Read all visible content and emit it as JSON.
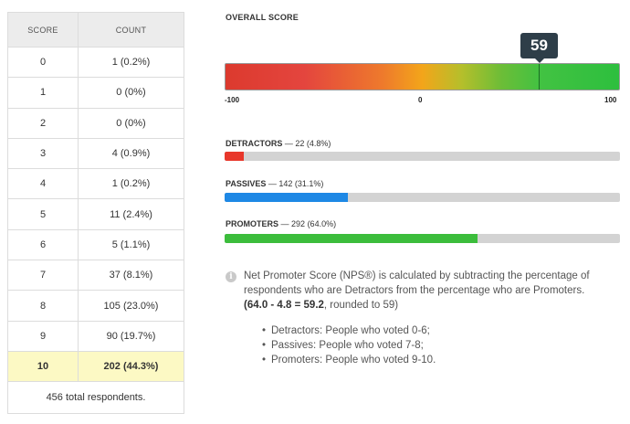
{
  "table": {
    "headers": {
      "score": "SCORE",
      "count": "COUNT"
    },
    "rows": [
      {
        "score": "0",
        "count": "1 (0.2%)"
      },
      {
        "score": "1",
        "count": "0 (0%)"
      },
      {
        "score": "2",
        "count": "0 (0%)"
      },
      {
        "score": "3",
        "count": "4 (0.9%)"
      },
      {
        "score": "4",
        "count": "1 (0.2%)"
      },
      {
        "score": "5",
        "count": "11 (2.4%)"
      },
      {
        "score": "6",
        "count": "5 (1.1%)"
      },
      {
        "score": "7",
        "count": "37 (8.1%)"
      },
      {
        "score": "8",
        "count": "105 (23.0%)"
      },
      {
        "score": "9",
        "count": "90 (19.7%)"
      },
      {
        "score": "10",
        "count": "202 (44.3%)"
      }
    ],
    "highlighted_row": 10,
    "footer": "456 total respondents."
  },
  "overall": {
    "label": "OVERALL SCORE",
    "score": 59,
    "score_text": "59",
    "min": -100,
    "max": 100,
    "tick_min": "-100",
    "tick_mid": "0",
    "tick_max": "100"
  },
  "breakdown": [
    {
      "name": "DETRACTORS",
      "detail": "22 (4.8%)",
      "percent": 4.8,
      "color": "#e8372b"
    },
    {
      "name": "PASSIVES",
      "detail": "142 (31.1%)",
      "percent": 31.1,
      "color": "#1e88e5"
    },
    {
      "name": "PROMOTERS",
      "detail": "292 (64.0%)",
      "percent": 64.0,
      "color": "#3cbd3c"
    }
  ],
  "note": {
    "icon": "info-icon",
    "text_line1": "Net Promoter Score (NPS®) is calculated by subtracting the percentage of",
    "text_line2": "respondents who are Detractors from the percentage who are Promoters.",
    "formula": "(64.0 - 4.8 = 59.2",
    "formula_suffix": ", rounded to 59)",
    "items": [
      "Detractors: People who voted 0-6;",
      "Passives: People who voted 7-8;",
      "Promoters: People who voted 9-10."
    ]
  }
}
